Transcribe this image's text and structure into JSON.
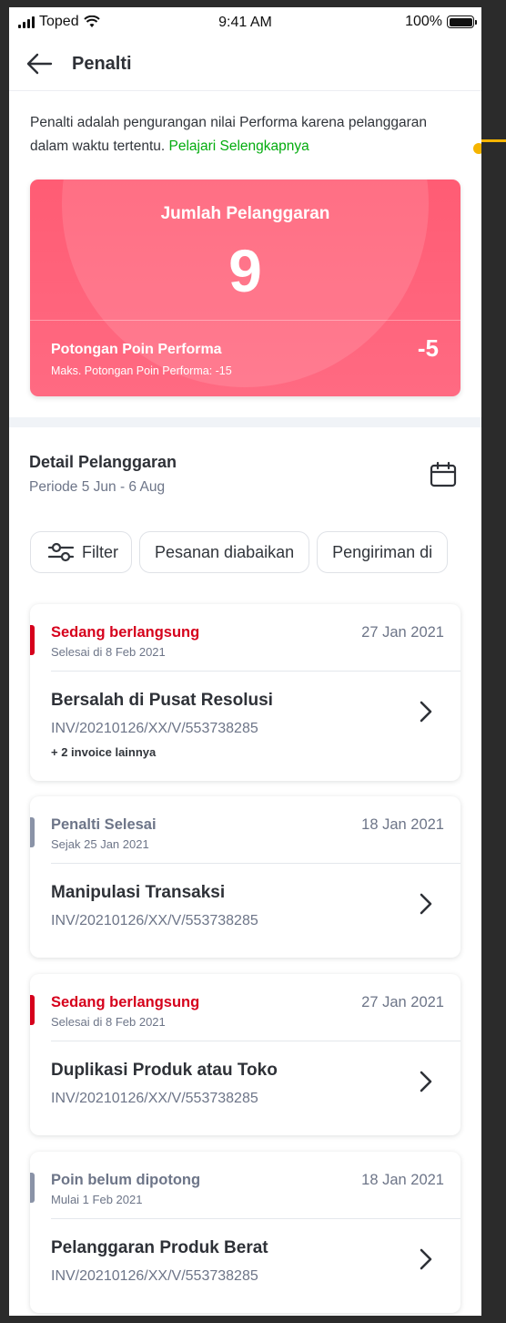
{
  "status_bar": {
    "carrier": "Toped",
    "time": "9:41 AM",
    "battery": "100%"
  },
  "header": {
    "title": "Penalti"
  },
  "intro": {
    "text": "Penalti adalah pengurangan nilai Performa karena pelanggaran dalam waktu tertentu.",
    "link": "Pelajari Selengkapnya"
  },
  "summary": {
    "label": "Jumlah Pelanggaran",
    "count": "9",
    "deduction_label": "Potongan Poin Performa",
    "deduction_value": "-5",
    "max_deduction": "Maks. Potongan Poin Performa: -15"
  },
  "detail": {
    "title": "Detail Pelanggaran",
    "period": "Periode 5 Jun - 6 Aug"
  },
  "chips": [
    "Filter",
    "Pesanan diabaikan",
    "Pengiriman di"
  ],
  "violations": [
    {
      "status": "Sedang berlangsung",
      "sub": "Selesai di 8 Feb 2021",
      "date": "27 Jan 2021",
      "title": "Bersalah di Pusat Resolusi",
      "invoice": "INV/20210126/XX/V/553738285",
      "more": "+ 2 invoice lainnya"
    },
    {
      "status": "Penalti Selesai",
      "sub": "Sejak 25 Jan 2021",
      "date": "18 Jan 2021",
      "title": "Manipulasi Transaksi",
      "invoice": "INV/20210126/XX/V/553738285"
    },
    {
      "status": "Sedang berlangsung",
      "sub": "Selesai di 8 Feb 2021",
      "date": "27 Jan 2021",
      "title": "Duplikasi Produk atau Toko",
      "invoice": "INV/20210126/XX/V/553738285"
    },
    {
      "status": "Poin belum dipotong",
      "sub": "Mulai 1 Feb 2021",
      "date": "18 Jan 2021",
      "title": "Pelanggaran Produk Berat",
      "invoice": "INV/20210126/XX/V/553738285"
    }
  ],
  "colors": {
    "brand_green": "#03ac0e",
    "status_red": "#d6001c",
    "card_red": "#ff5c74",
    "status_grey": "#8a93a7"
  },
  "icons": [
    "signal-icon",
    "wifi-icon",
    "battery-icon",
    "back-arrow-icon",
    "calendar-icon",
    "filter-sliders-icon",
    "chevron-right-icon"
  ]
}
